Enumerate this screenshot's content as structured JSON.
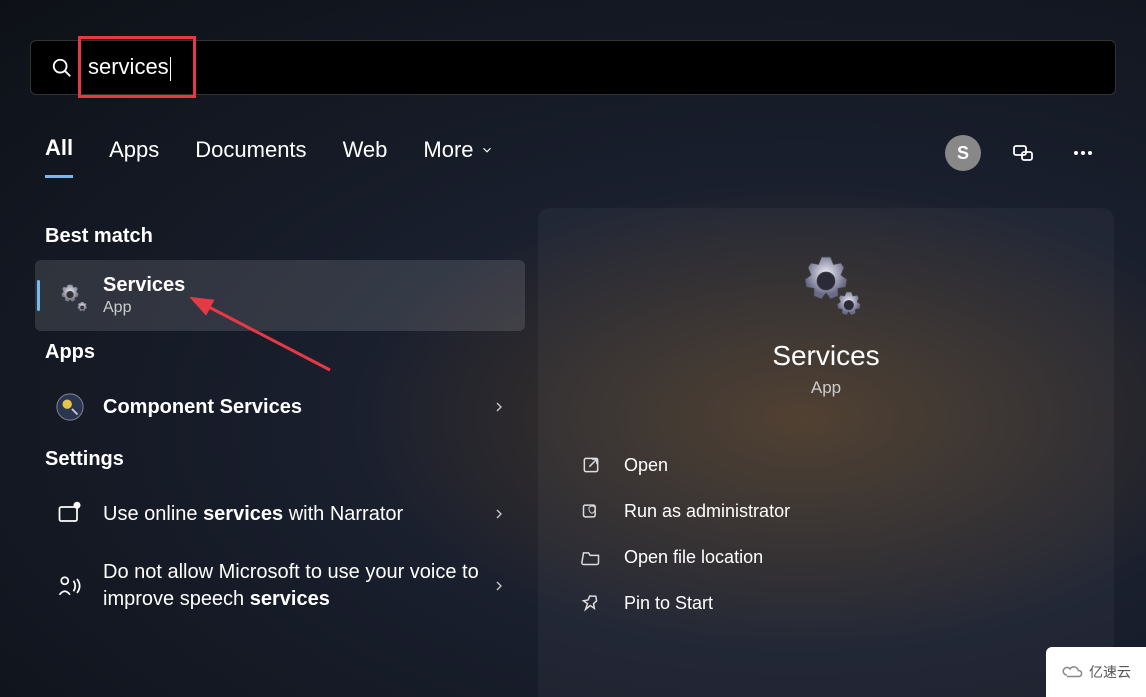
{
  "search": {
    "value": "services"
  },
  "tabs": {
    "all": "All",
    "apps": "Apps",
    "documents": "Documents",
    "web": "Web",
    "more": "More"
  },
  "avatar_letter": "S",
  "sections": {
    "best_match": "Best match",
    "apps": "Apps",
    "settings": "Settings"
  },
  "best_match": {
    "title": "Services",
    "subtitle": "App"
  },
  "apps_results": [
    {
      "prefix": "Component ",
      "bold": "Services"
    }
  ],
  "settings_results": [
    {
      "text_a": "Use online ",
      "bold": "services",
      "text_b": " with Narrator"
    },
    {
      "text_a": "Do not allow Microsoft to use your voice to improve speech ",
      "bold": "services",
      "text_b": ""
    }
  ],
  "detail": {
    "title": "Services",
    "subtitle": "App"
  },
  "actions": {
    "open": "Open",
    "admin": "Run as administrator",
    "location": "Open file location",
    "pin": "Pin to Start"
  },
  "watermark": "亿速云"
}
